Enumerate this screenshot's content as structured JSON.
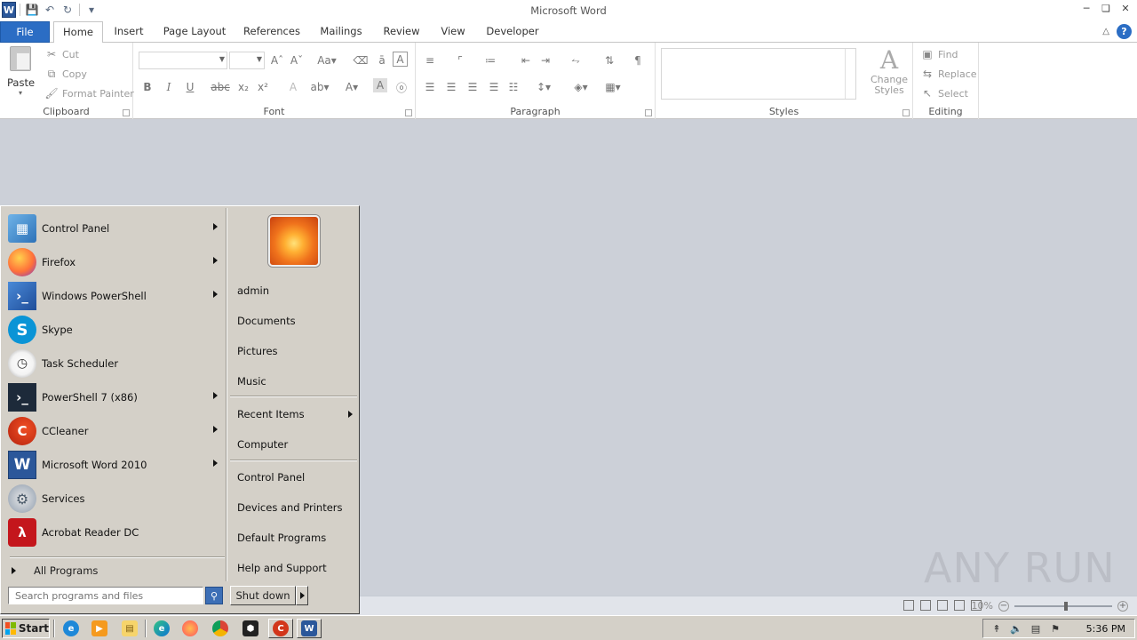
{
  "window": {
    "title": "Microsoft Word"
  },
  "tabs": [
    {
      "label": "File"
    },
    {
      "label": "Home"
    },
    {
      "label": "Insert"
    },
    {
      "label": "Page Layout"
    },
    {
      "label": "References"
    },
    {
      "label": "Mailings"
    },
    {
      "label": "Review"
    },
    {
      "label": "View"
    },
    {
      "label": "Developer"
    }
  ],
  "ribbon": {
    "clipboard": {
      "label": "Clipboard",
      "paste": "Paste",
      "cut": "Cut",
      "copy": "Copy",
      "format_painter": "Format Painter"
    },
    "font": {
      "label": "Font"
    },
    "paragraph": {
      "label": "Paragraph"
    },
    "styles": {
      "label": "Styles",
      "change_styles_1": "Change",
      "change_styles_2": "Styles"
    },
    "editing": {
      "label": "Editing",
      "find": "Find",
      "replace": "Replace",
      "select": "Select"
    }
  },
  "status": {
    "zoom": "10%"
  },
  "watermark": "ANY RUN",
  "start_menu": {
    "programs": [
      {
        "label": "Control Panel",
        "icon": "control-panel-icon",
        "arrow": true
      },
      {
        "label": "Firefox",
        "icon": "firefox-icon",
        "arrow": true
      },
      {
        "label": "Windows PowerShell",
        "icon": "powershell-icon",
        "arrow": true
      },
      {
        "label": "Skype",
        "icon": "skype-icon",
        "arrow": false
      },
      {
        "label": "Task Scheduler",
        "icon": "task-scheduler-icon",
        "arrow": false
      },
      {
        "label": "PowerShell 7 (x86)",
        "icon": "powershell7-icon",
        "arrow": true
      },
      {
        "label": "CCleaner",
        "icon": "ccleaner-icon",
        "arrow": true
      },
      {
        "label": "Microsoft Word 2010",
        "icon": "word-icon",
        "arrow": true
      },
      {
        "label": "Services",
        "icon": "services-icon",
        "arrow": false
      },
      {
        "label": "Acrobat Reader DC",
        "icon": "acrobat-icon",
        "arrow": false
      }
    ],
    "all_programs": "All Programs",
    "right": {
      "user": "admin",
      "documents": "Documents",
      "pictures": "Pictures",
      "music": "Music",
      "recent_items": "Recent Items",
      "computer": "Computer",
      "control_panel": "Control Panel",
      "devices_printers": "Devices and Printers",
      "default_programs": "Default Programs",
      "help_support": "Help and Support"
    },
    "search_placeholder": "Search programs and files",
    "shutdown": "Shut down"
  },
  "taskbar": {
    "start": "Start",
    "clock": "5:36 PM"
  },
  "colors": {
    "file_tab": "#2b6dc4",
    "desktop": "#ccd0d8",
    "taskbar": "#d4d0c8"
  }
}
